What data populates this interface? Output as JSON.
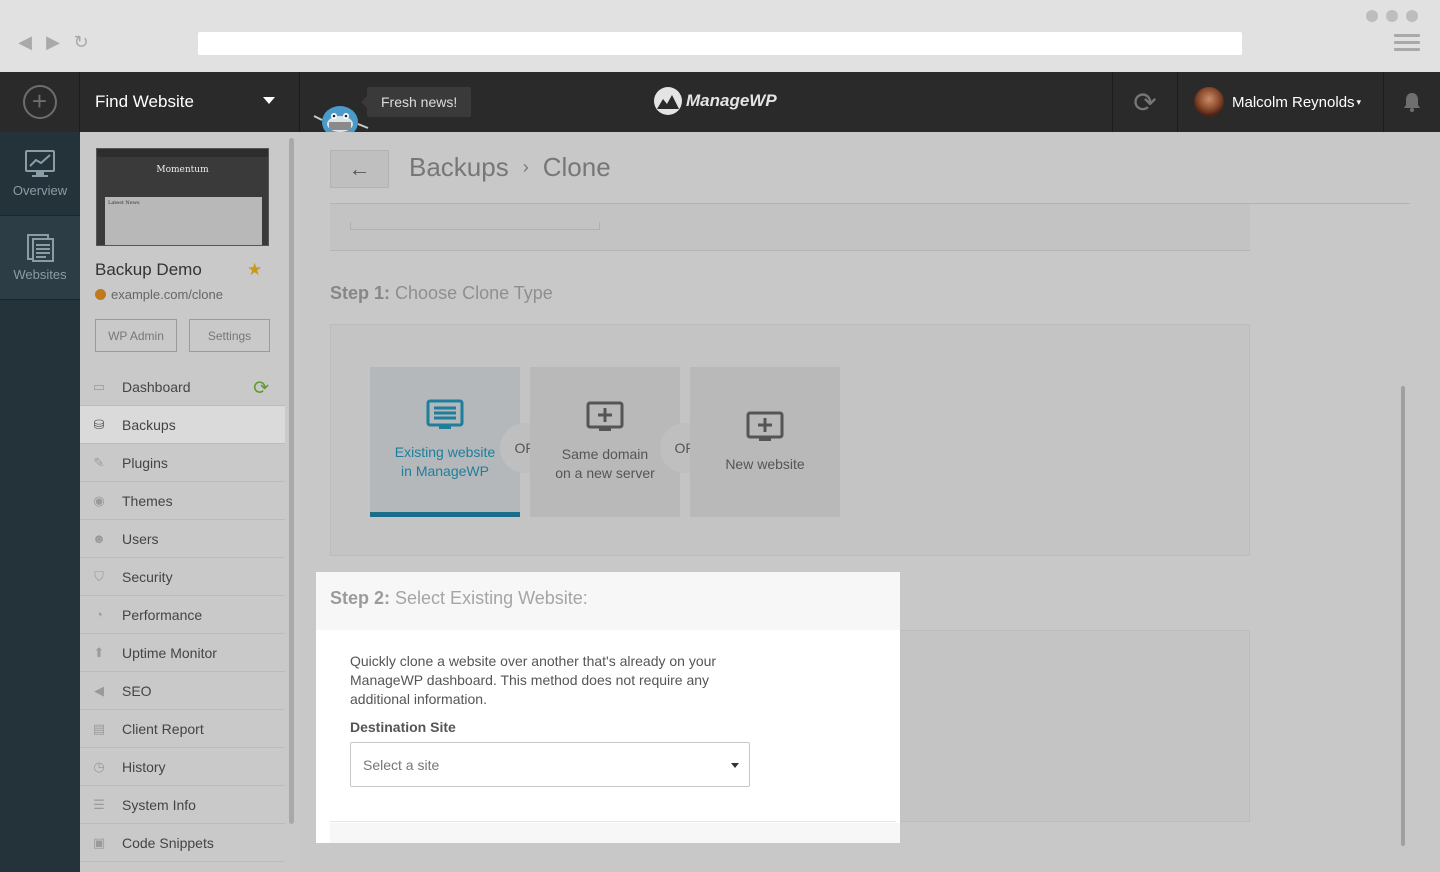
{
  "topbar": {
    "find_label": "Find Website",
    "news_label": "Fresh news!",
    "logo_text": "ManageWP",
    "user_name": "Malcolm Reynolds"
  },
  "rail": {
    "items": [
      {
        "label": "Overview",
        "icon": "chart-monitor-icon"
      },
      {
        "label": "Websites",
        "icon": "pages-icon"
      }
    ]
  },
  "site": {
    "thumb_title": "Momentum",
    "thumb_news": "Latest News",
    "name": "Backup Demo",
    "url": "example.com/clone",
    "wp_admin_label": "WP Admin",
    "settings_label": "Settings"
  },
  "menu": [
    {
      "label": "Dashboard",
      "icon": "monitor-icon"
    },
    {
      "label": "Backups",
      "icon": "backup-icon"
    },
    {
      "label": "Plugins",
      "icon": "plug-icon"
    },
    {
      "label": "Themes",
      "icon": "palette-icon"
    },
    {
      "label": "Users",
      "icon": "user-icon"
    },
    {
      "label": "Security",
      "icon": "shield-icon"
    },
    {
      "label": "Performance",
      "icon": "gauge-icon"
    },
    {
      "label": "Uptime Monitor",
      "icon": "arrow-up-icon"
    },
    {
      "label": "SEO",
      "icon": "megaphone-icon"
    },
    {
      "label": "Client Report",
      "icon": "report-icon"
    },
    {
      "label": "History",
      "icon": "clock-icon"
    },
    {
      "label": "System Info",
      "icon": "server-icon"
    },
    {
      "label": "Code Snippets",
      "icon": "code-icon"
    }
  ],
  "breadcrumb": {
    "parent": "Backups",
    "separator": "›",
    "current": "Clone"
  },
  "step1": {
    "prefix": "Step 1:",
    "title": "Choose Clone Type",
    "or_label": "OR",
    "options": [
      {
        "line1": "Existing website",
        "line2": "in ManageWP",
        "selected": true
      },
      {
        "line1": "Same domain",
        "line2": "on a new server",
        "selected": false
      },
      {
        "line1": "New website",
        "line2": "",
        "selected": false
      }
    ]
  },
  "step2": {
    "prefix": "Step 2:",
    "title": "Select Existing Website:",
    "description": "Quickly clone a website over another that's already on your ManageWP dashboard. This method does not require any additional information.",
    "destination_label": "Destination Site",
    "select_placeholder": "Select a site"
  },
  "colors": {
    "accent": "#1f7e9b",
    "topbar": "#2a2a2a",
    "rail": "#24333a",
    "refresh_green": "#5c9c2e",
    "star": "#c79a19"
  }
}
